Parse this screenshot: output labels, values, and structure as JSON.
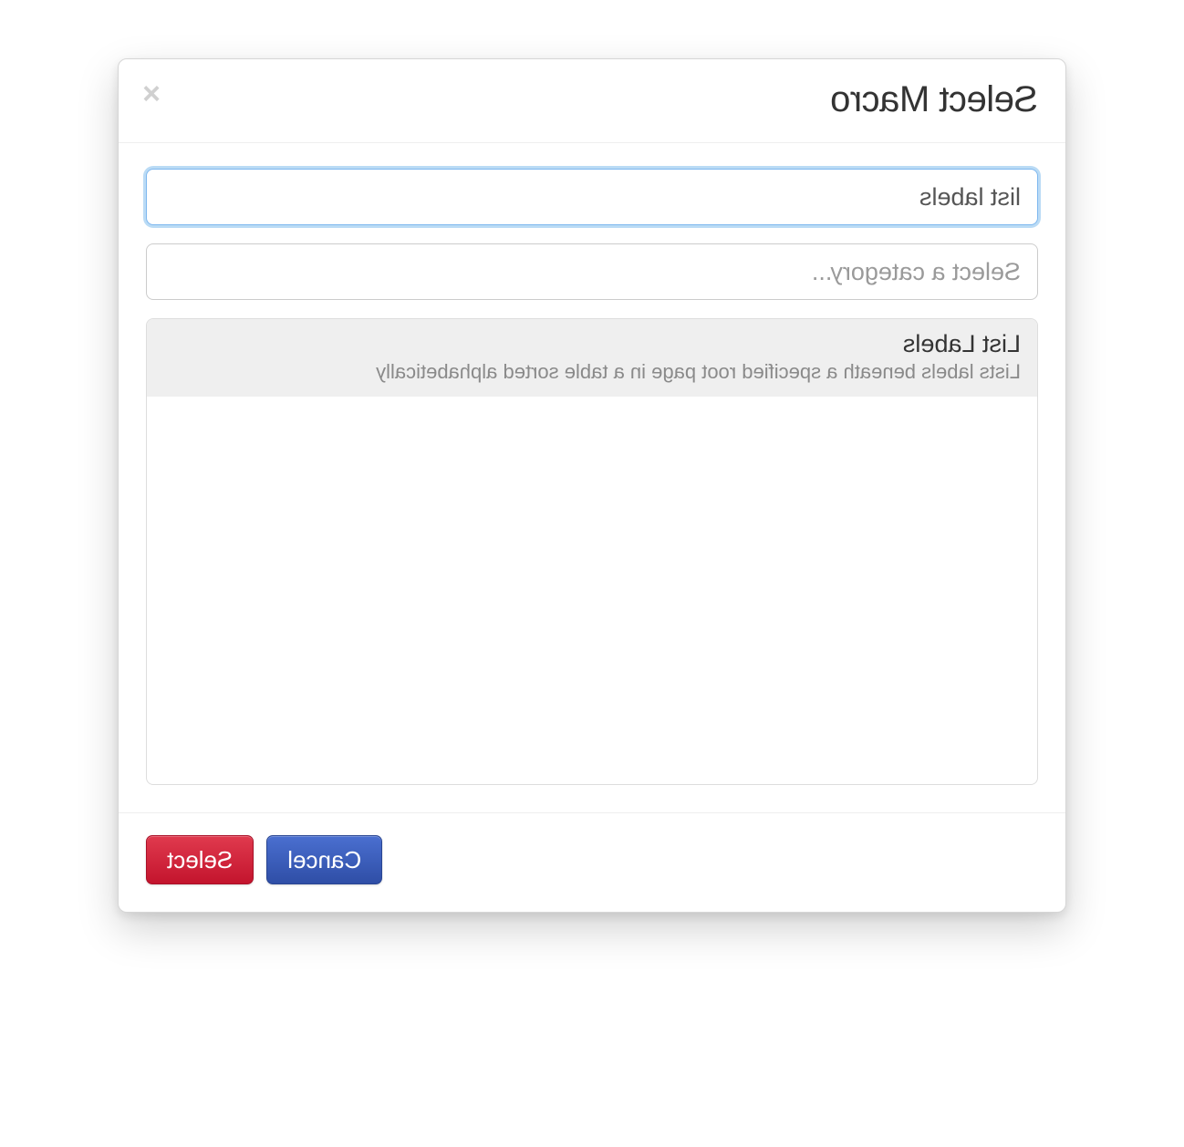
{
  "colors": {
    "primary_button": "#c3142d",
    "secondary_button": "#2f4ea6",
    "focus_ring": "#66afe9"
  },
  "modal": {
    "title": "Select Macro",
    "close_label": "×"
  },
  "search": {
    "value": "list labels"
  },
  "category": {
    "placeholder": "Select a category..."
  },
  "results": [
    {
      "title": "List Labels",
      "description": "Lists labels beneath a specified root page in a table sorted alphabetically"
    }
  ],
  "footer": {
    "cancel_label": "Cancel",
    "select_label": "Select"
  }
}
